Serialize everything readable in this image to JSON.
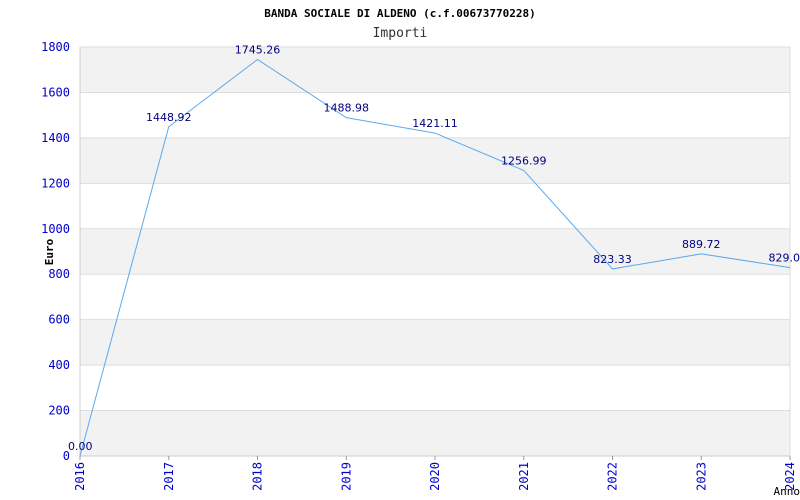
{
  "chart_data": {
    "type": "line",
    "title": "BANDA SOCIALE DI ALDENO (c.f.00673770228)",
    "subtitle": "Importi",
    "xlabel": "Anno",
    "ylabel": "Euro",
    "categories": [
      "2016",
      "2017",
      "2018",
      "2019",
      "2020",
      "2021",
      "2022",
      "2023",
      "2024"
    ],
    "values": [
      0.0,
      1448.92,
      1745.26,
      1488.98,
      1421.11,
      1256.99,
      823.33,
      889.72,
      829.0
    ],
    "value_labels": [
      "0.00",
      "1448.92",
      "1745.26",
      "1488.98",
      "1421.11",
      "1256.99",
      "823.33",
      "889.72",
      "829.0"
    ],
    "ylim": [
      0,
      1800
    ],
    "yticks": [
      0,
      200,
      400,
      600,
      800,
      1000,
      1200,
      1400,
      1600,
      1800
    ],
    "grid": true,
    "colors": {
      "line": "#5aa9ee",
      "axis_text": "#0000cc",
      "value_text": "#000080",
      "band": "#f2f2f2",
      "grid": "#dddddd"
    }
  }
}
